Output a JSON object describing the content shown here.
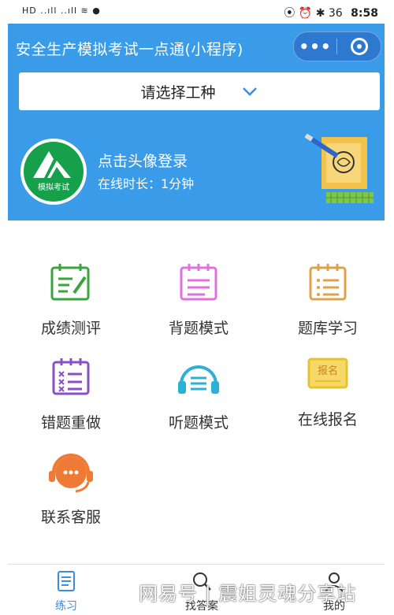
{
  "status_bar": {
    "left_text": "HD ..ıll ..ıll ≋ ●",
    "right_icons": "⦿ ⏰ ✱ 36",
    "time": "8:58"
  },
  "header": {
    "title": "安全生产模拟考试一点通(小程序)",
    "capsule_more": "•••",
    "selector_placeholder": "请选择工种",
    "avatar_label": "模拟考试",
    "login_text": "点击头像登录",
    "online_time": "在线时长：1分钟",
    "background_color": "#3a9ce9"
  },
  "grid": [
    {
      "label": "成绩测评",
      "icon": "clipboard-pen-icon",
      "color": "#3aa53c"
    },
    {
      "label": "背题模式",
      "icon": "notepad-icon",
      "color": "#e26fe0"
    },
    {
      "label": "题库学习",
      "icon": "notepad-list-icon",
      "color": "#e0a14a"
    },
    {
      "label": "错题重做",
      "icon": "wrong-list-icon",
      "color": "#8a4ec7"
    },
    {
      "label": "听题模式",
      "icon": "headphones-icon",
      "color": "#2bb0d6"
    },
    {
      "label": "在线报名",
      "icon": "register-badge-icon",
      "color": "#e6c22e"
    },
    {
      "label": "联系客服",
      "icon": "customer-service-icon",
      "color": "#ef7a35"
    }
  ],
  "register_badge_text": "报名",
  "tabbar": [
    {
      "label": "练习",
      "icon": "practice-icon",
      "active": true
    },
    {
      "label": "找答案",
      "icon": "search-icon",
      "active": false
    },
    {
      "label": "我的",
      "icon": "profile-icon",
      "active": false
    }
  ],
  "watermark": "网易号 | 震姐灵魂分享站"
}
